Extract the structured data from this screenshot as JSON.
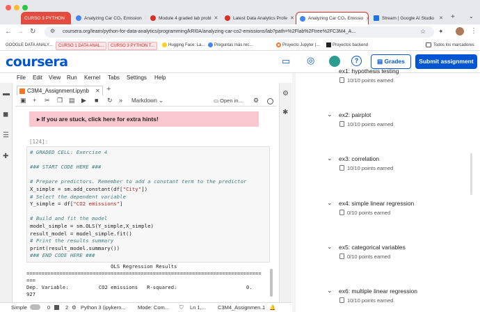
{
  "browser": {
    "tabs": [
      {
        "label": "CURSO 3 PYTHON",
        "color": "#d93025"
      },
      {
        "label": "Analyzing Car CO₂ Emission",
        "color": "#4285f4"
      },
      {
        "label": "Module 4 graded lab probl",
        "color": "#d93025"
      },
      {
        "label": "Latest Data Analytics Profe",
        "color": "#d93025"
      },
      {
        "label": "Analyzing Car CO₂ Emissio",
        "color": "#4285f4"
      },
      {
        "label": "Stream | Google AI Studio",
        "color": "#1a73e8"
      }
    ],
    "url": "coursera.org/learn/python-for-data-analytics/programming/kRI0A/analyzing-car-co2-emissions/lab?path=%2Flab%2Ftree%2FC3M4_A...",
    "bookmarks": [
      "GOOGLE DATA ANALY...",
      "CURSO 1 DATA ANAL...",
      "CURSO 3 PYTHON T...",
      "Hugging Face: La...",
      "Preguntas más rec...",
      "Proyecto Jupyter |...",
      "Proyectos backend",
      "Todos los marcadores"
    ]
  },
  "header": {
    "logo": "coursera",
    "grades": "Grades",
    "submit": "Submit assignment"
  },
  "menu": [
    "File",
    "Edit",
    "View",
    "Run",
    "Kernel",
    "Tabs",
    "Settings",
    "Help"
  ],
  "notebook": {
    "tab": "C3M4_Assignment.ipynb",
    "cell_type": "Markdown",
    "open_in": "Open in...",
    "hint": "▸ If you are stuck, click here for extra hints!",
    "prompt": "[124]:",
    "code": [
      "# GRADED CELL: Exercise 4",
      "",
      "### START CODE HERE ###",
      "",
      "# Prepare predictors. Remember to add a constant term to the predictor",
      "X_simple = sm.add_constant(df[\"City\"])",
      "# Select the dependent variable",
      "Y_simple = df[\"CO2 emissions\"]",
      "",
      "# Build and fit the model",
      "model_simple = sm.OLS(Y_simple,X_simple)",
      "result_model = model_simple.fit()",
      "# Print the results summary",
      "print(result_model.summary())",
      "### END CODE HERE ###"
    ],
    "output": [
      "                            OLS Regression Results",
      "==============================================================================",
      "===",
      "Dep. Variable:          CO2 emissions   R-squared:                       0.",
      "927"
    ]
  },
  "status": {
    "mode": "Simple",
    "zero": "0",
    "two": "2",
    "kernel": "Python 3 (ipykern...",
    "cmd": "Mode: Com...",
    "ln": "Ln 1,...",
    "file": "C3M4_Assignmen...",
    "one": "1"
  },
  "exercises": [
    {
      "title": "ex1: hypothesis testing",
      "points": "10/10 points earned"
    },
    {
      "title": "ex2: pairplot",
      "points": "10/10 points earned"
    },
    {
      "title": "ex3: correlation",
      "points": "10/10 points earned"
    },
    {
      "title": "ex4: simple linear regression",
      "points": "0/10 points earned"
    },
    {
      "title": "ex5: categorical variables",
      "points": "0/10 points earned"
    },
    {
      "title": "ex6: multiple linear regression",
      "points": "10/10 points earned"
    }
  ]
}
